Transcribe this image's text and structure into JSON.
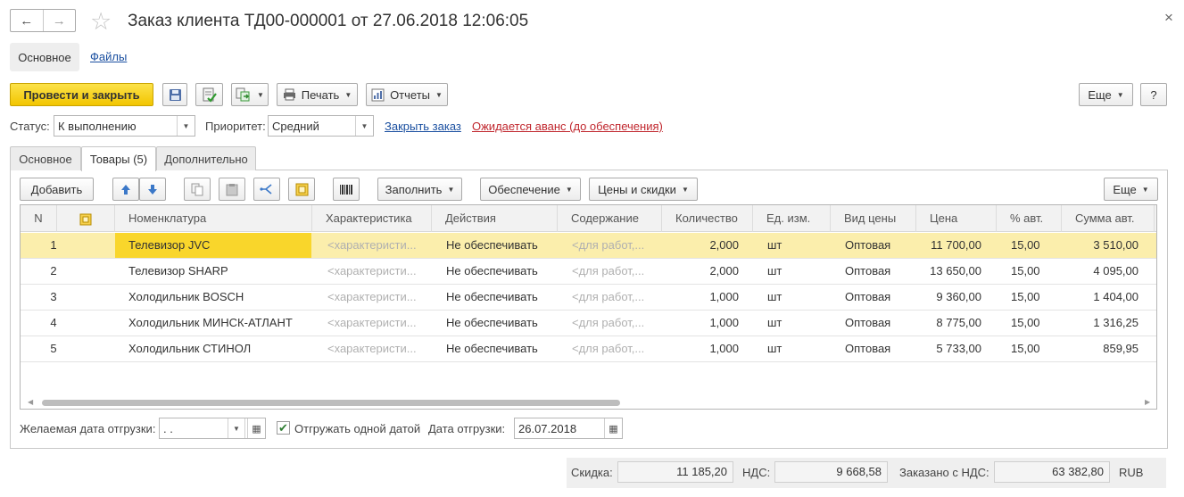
{
  "header": {
    "back": "←",
    "forward": "→",
    "favorite": "☆",
    "title": "Заказ клиента ТД00-000001 от 27.06.2018 12:06:05",
    "close": "×"
  },
  "page_tabs": [
    {
      "label": "Основное",
      "active": true
    },
    {
      "label": "Файлы",
      "active": false
    }
  ],
  "toolbar": {
    "post_close": "Провести и закрыть",
    "print": "Печать",
    "reports": "Отчеты",
    "more": "Еще",
    "help": "?"
  },
  "status_row": {
    "status_label": "Статус:",
    "status_value": "К выполнению",
    "priority_label": "Приоритет:",
    "priority_value": "Средний",
    "close_order": "Закрыть заказ",
    "awaiting_advance": "Ожидается аванс (до обеспечения)"
  },
  "inner_tabs": [
    {
      "label": "Основное"
    },
    {
      "label": "Товары (5)"
    },
    {
      "label": "Дополнительно"
    }
  ],
  "table_toolbar": {
    "add": "Добавить",
    "fill": "Заполнить",
    "provision": "Обеспечение",
    "prices": "Цены и скидки",
    "more": "Еще"
  },
  "table": {
    "columns": [
      "N",
      "Номенклатура",
      "Характеристика",
      "Действия",
      "Содержание",
      "Количество",
      "Ед. изм.",
      "Вид цены",
      "Цена",
      "% авт.",
      "Сумма авт."
    ],
    "rows": [
      {
        "n": "1",
        "item": "Телевизор JVC",
        "char": "<характеристи...",
        "action": "Не обеспечивать",
        "content": "<для работ,...",
        "qty": "2,000",
        "unit": "шт",
        "price_type": "Оптовая",
        "price": "11 700,00",
        "pct": "15,00",
        "sum": "3 510,00"
      },
      {
        "n": "2",
        "item": "Телевизор SHARP",
        "char": "<характеристи...",
        "action": "Не обеспечивать",
        "content": "<для работ,...",
        "qty": "2,000",
        "unit": "шт",
        "price_type": "Оптовая",
        "price": "13 650,00",
        "pct": "15,00",
        "sum": "4 095,00"
      },
      {
        "n": "3",
        "item": "Холодильник BOSCH",
        "char": "<характеристи...",
        "action": "Не обеспечивать",
        "content": "<для работ,...",
        "qty": "1,000",
        "unit": "шт",
        "price_type": "Оптовая",
        "price": "9 360,00",
        "pct": "15,00",
        "sum": "1 404,00"
      },
      {
        "n": "4",
        "item": "Холодильник МИНСК-АТЛАНТ",
        "char": "<характеристи...",
        "action": "Не обеспечивать",
        "content": "<для работ,...",
        "qty": "1,000",
        "unit": "шт",
        "price_type": "Оптовая",
        "price": "8 775,00",
        "pct": "15,00",
        "sum": "1 316,25"
      },
      {
        "n": "5",
        "item": "Холодильник СТИНОЛ",
        "char": "<характеристи...",
        "action": "Не обеспечивать",
        "content": "<для работ,...",
        "qty": "1,000",
        "unit": "шт",
        "price_type": "Оптовая",
        "price": "5 733,00",
        "pct": "15,00",
        "sum": "859,95"
      }
    ]
  },
  "shipping": {
    "desired_label": "Желаемая дата отгрузки:",
    "desired_value": " .  .",
    "single_date_label": "Отгружать одной датой",
    "single_date_checked": true,
    "ship_date_label": "Дата отгрузки:",
    "ship_date_value": "26.07.2018"
  },
  "totals": {
    "discount_label": "Скидка:",
    "discount_value": "11 185,20",
    "vat_label": "НДС:",
    "vat_value": "9 668,58",
    "ordered_label": "Заказано с НДС:",
    "ordered_value": "63 382,80",
    "currency": "RUB"
  },
  "colors": {
    "primary_button": "#f2c500",
    "selected_row": "#fbeeac",
    "current_cell": "#f9d62b",
    "link": "#1a4fa0",
    "warning_link": "#c0262d"
  }
}
